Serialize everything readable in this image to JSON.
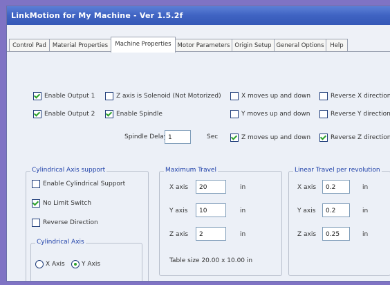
{
  "window": {
    "title": "LinkMotion for My Machine - Ver 1.5.2f"
  },
  "tabs": [
    {
      "label": "Control Pad"
    },
    {
      "label": "Material Properties"
    },
    {
      "label": "Machine Properties"
    },
    {
      "label": "Motor Parameters"
    },
    {
      "label": "Origin Setup"
    },
    {
      "label": "General Options"
    },
    {
      "label": "Help"
    }
  ],
  "machine": {
    "enable_output_1": {
      "label": "Enable Output 1",
      "checked": true
    },
    "enable_output_2": {
      "label": "Enable Output 2",
      "checked": true
    },
    "z_axis_solenoid": {
      "label": "Z axis is Solenoid (Not Motorized)",
      "checked": false
    },
    "enable_spindle": {
      "label": "Enable Spindle",
      "checked": true
    },
    "x_moves_up_down": {
      "label": "X moves up and down",
      "checked": false
    },
    "y_moves_up_down": {
      "label": "Y moves up and down",
      "checked": false
    },
    "z_moves_up_down": {
      "label": "Z moves up and down",
      "checked": true
    },
    "reverse_x": {
      "label": "Reverse X direction",
      "checked": false
    },
    "reverse_y": {
      "label": "Reverse Y direction",
      "checked": false
    },
    "reverse_z": {
      "label": "Reverse Z direction",
      "checked": true
    },
    "spindle_delay": {
      "label": "Spindle Delay",
      "value": "1",
      "unit": "Sec"
    }
  },
  "cylindrical": {
    "title": "Cylindrical Axis support",
    "enable_support": {
      "label": "Enable Cylindrical Support",
      "checked": false
    },
    "no_limit_switch": {
      "label": "No Limit Switch",
      "checked": true
    },
    "reverse_direction": {
      "label": "Reverse Direction",
      "checked": false
    },
    "axis_group": {
      "title": "Cylindrical Axis",
      "options": [
        "X Axis",
        "Y Axis"
      ],
      "selected": "Y Axis"
    }
  },
  "max_travel": {
    "title": "Maximum Travel",
    "rows": [
      {
        "label": "X axis",
        "value": "20",
        "unit": "in"
      },
      {
        "label": "Y axis",
        "value": "10",
        "unit": "in"
      },
      {
        "label": "Z axis",
        "value": "2",
        "unit": "in"
      }
    ],
    "table_size": "Table size 20.00 x 10.00 in"
  },
  "linear_travel": {
    "title": "Linear Travel per revolution",
    "rows": [
      {
        "label": "X axis",
        "value": "0.2",
        "unit": "in"
      },
      {
        "label": "Y axis",
        "value": "0.2",
        "unit": "in"
      },
      {
        "label": "Z axis",
        "value": "0.25",
        "unit": "in"
      }
    ]
  },
  "colors": {
    "title_bar": "#3f63c2",
    "group_title": "#1d3fa8",
    "check": "#2aa02a",
    "frame": "#7f73c4"
  }
}
